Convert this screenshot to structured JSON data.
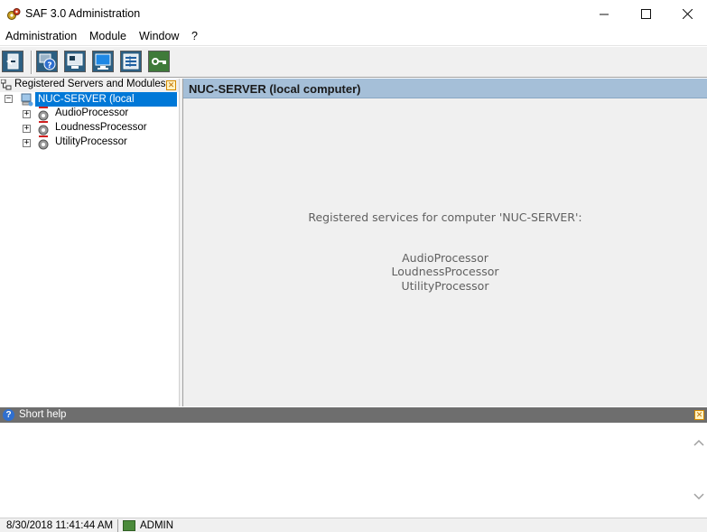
{
  "window": {
    "title": "SAF 3.0 Administration"
  },
  "menu": {
    "items": [
      "Administration",
      "Module",
      "Window",
      "?"
    ]
  },
  "toolbar": {
    "buttons": [
      "exit-icon",
      "help-icon",
      "module-icon",
      "monitor-icon",
      "list-icon",
      "key-icon"
    ]
  },
  "left_panel": {
    "title": "Registered Servers and Modules",
    "root": "NUC-SERVER (local computer)",
    "nodes": [
      "AudioProcessor",
      "LoudnessProcessor",
      "UtilityProcessor"
    ]
  },
  "right_panel": {
    "title": "NUC-SERVER (local computer)",
    "heading": "Registered services for computer 'NUC-SERVER':",
    "services": [
      "AudioProcessor",
      "LoudnessProcessor",
      "UtilityProcessor"
    ]
  },
  "help": {
    "title": "Short help"
  },
  "status": {
    "datetime": "8/30/2018 11:41:44 AM",
    "user": "ADMIN"
  },
  "colors": {
    "selection": "#0078d7",
    "panel_header": "#a5bfd8",
    "help_header": "#6e6e6e"
  }
}
